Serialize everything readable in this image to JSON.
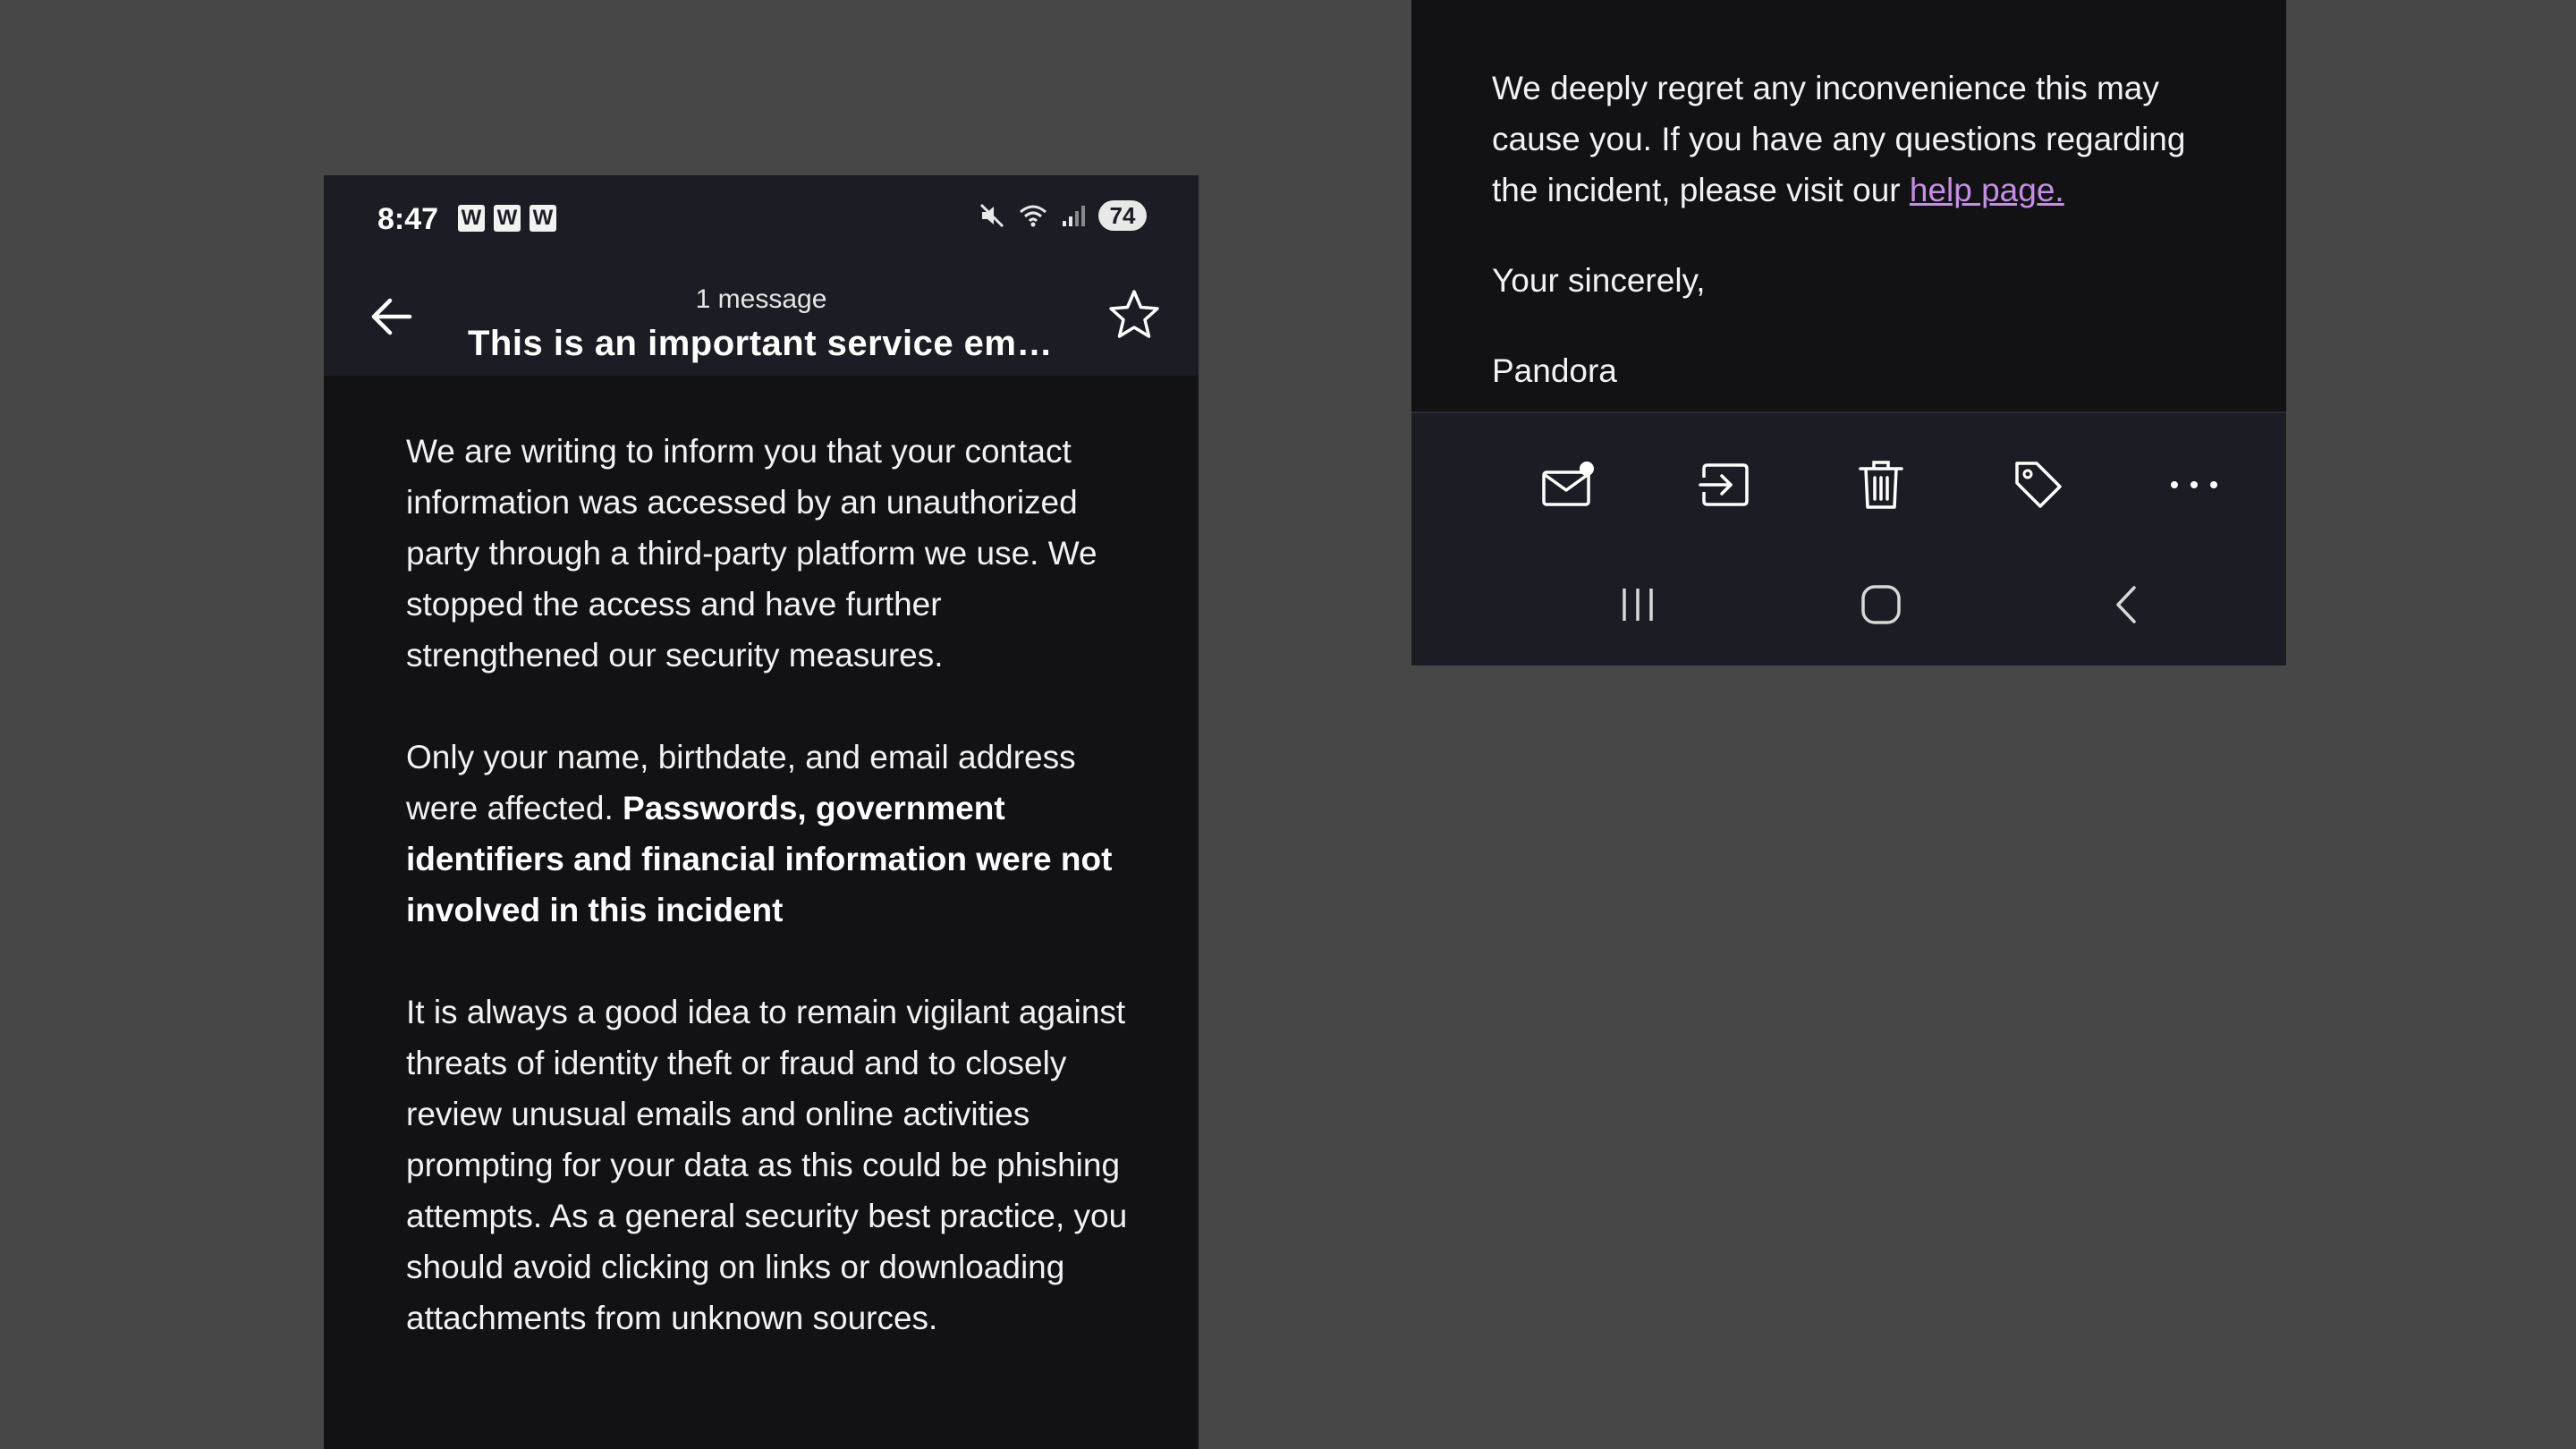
{
  "left_phone": {
    "status_bar": {
      "time": "8:47",
      "notification_icons": [
        "W",
        "W",
        "W"
      ],
      "battery": "74"
    },
    "app_bar": {
      "message_count": "1 message",
      "subject": "This is an important service em…"
    },
    "body": {
      "paragraph_1": "We are writing to inform you that your contact information was accessed by an unauthorized party through a third-party platform we use. We stopped the access and have further strengthened our security measures.",
      "paragraph_2_normal": "Only your name, birthdate, and email address were affected. ",
      "paragraph_2_bold": "Passwords, government identifiers and financial information were not involved in this incident",
      "paragraph_3": "It is always a good idea to remain vigilant against threats of identity theft or fraud and to closely review unusual emails and online activities prompting for your data as this could be phishing attempts. As a general security best practice, you should avoid clicking on links or downloading attachments from unknown sources."
    }
  },
  "right_phone": {
    "body": {
      "paragraph_1": "We deeply regret any inconvenience this may cause you. If you have any questions regarding the incident, please visit our ",
      "help_link": "help page.",
      "closing": "Your sincerely,",
      "signature": "Pandora"
    },
    "toolbar_icons": [
      "mark-unread-icon",
      "move-to-folder-icon",
      "trash-icon",
      "label-tag-icon",
      "more-options-icon"
    ],
    "nav_icons": [
      "recent-apps-icon",
      "home-icon",
      "nav-back-icon"
    ]
  },
  "colors": {
    "page_background": "#474747",
    "screen_background": "#121214",
    "bar_background": "#1c1c24",
    "link": "#c58de8"
  }
}
